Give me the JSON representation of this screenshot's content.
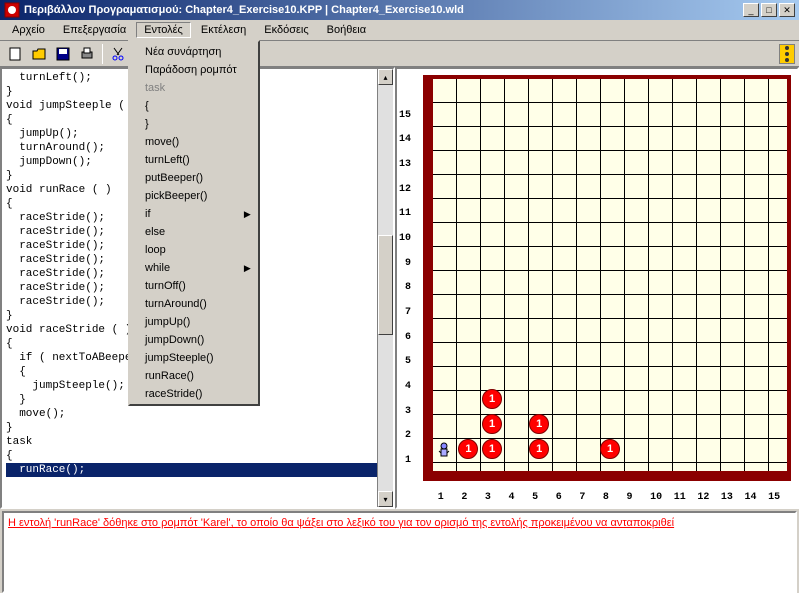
{
  "title": "Περιβάλλον Προγραματισμού: Chapter4_Exercise10.KPP  |  Chapter4_Exercise10.wld",
  "menus": {
    "file": "Αρχείο",
    "edit": "Επεξεργασία",
    "commands": "Εντολές",
    "run": "Εκτέλεση",
    "versions": "Εκδόσεις",
    "help": "Βοήθεια"
  },
  "dropdown": {
    "items": [
      {
        "label": "Νέα συνάρτηση",
        "enabled": true
      },
      {
        "label": "Παράδοση ρομπότ",
        "enabled": true
      },
      {
        "label": "task",
        "enabled": false
      },
      {
        "label": "{",
        "enabled": true
      },
      {
        "label": "}",
        "enabled": true
      },
      {
        "label": "move()",
        "enabled": true
      },
      {
        "label": "turnLeft()",
        "enabled": true
      },
      {
        "label": "putBeeper()",
        "enabled": true
      },
      {
        "label": "pickBeeper()",
        "enabled": true
      },
      {
        "label": "if",
        "enabled": true,
        "submenu": true
      },
      {
        "label": "else",
        "enabled": true
      },
      {
        "label": "loop",
        "enabled": true
      },
      {
        "label": "while",
        "enabled": true,
        "submenu": true
      },
      {
        "label": "turnOff()",
        "enabled": true
      },
      {
        "label": "turnAround()",
        "enabled": true
      },
      {
        "label": "jumpUp()",
        "enabled": true
      },
      {
        "label": "jumpDown()",
        "enabled": true
      },
      {
        "label": "jumpSteeple()",
        "enabled": true
      },
      {
        "label": "runRace()",
        "enabled": true
      },
      {
        "label": "raceStride()",
        "enabled": true
      }
    ]
  },
  "code": {
    "lines": [
      "  turnLeft();",
      "}",
      "void jumpSteeple ( )",
      "{",
      "  jumpUp();",
      "  turnAround();",
      "  jumpDown();",
      "}",
      "void runRace ( )",
      "{",
      "  raceStride();",
      "  raceStride();",
      "  raceStride();",
      "  raceStride();",
      "  raceStride();",
      "  raceStride();",
      "  raceStride();",
      "}",
      "void raceStride ( )",
      "{",
      "  if ( nextToABeeper )",
      "  {",
      "    jumpSteeple();",
      "  }",
      "  move();",
      "}",
      "task",
      "{",
      "  runRace();"
    ],
    "selected_index": 28
  },
  "world": {
    "cols": 15,
    "rows": 15,
    "x_labels": [
      "1",
      "2",
      "3",
      "4",
      "5",
      "6",
      "7",
      "8",
      "9",
      "10",
      "11",
      "12",
      "13",
      "14",
      "15"
    ],
    "y_labels": [
      "1",
      "2",
      "3",
      "4",
      "5",
      "6",
      "7",
      "8",
      "9",
      "10",
      "11",
      "12",
      "13",
      "14",
      "15"
    ],
    "beepers": [
      {
        "col": 2,
        "row": 1,
        "count": "1"
      },
      {
        "col": 3,
        "row": 1,
        "count": "1"
      },
      {
        "col": 5,
        "row": 1,
        "count": "1"
      },
      {
        "col": 8,
        "row": 1,
        "count": "1"
      },
      {
        "col": 3,
        "row": 2,
        "count": "1"
      },
      {
        "col": 5,
        "row": 2,
        "count": "1"
      },
      {
        "col": 3,
        "row": 3,
        "count": "1"
      }
    ],
    "robot": {
      "col": 1,
      "row": 1
    }
  },
  "status": "Η εντολή 'runRace' δόθηκε στο ρομπότ 'Karel', το οποίο θα ψάξει στο λεξικό του για τον ορισμό της εντολής προκειμένου να ανταποκριθεί"
}
